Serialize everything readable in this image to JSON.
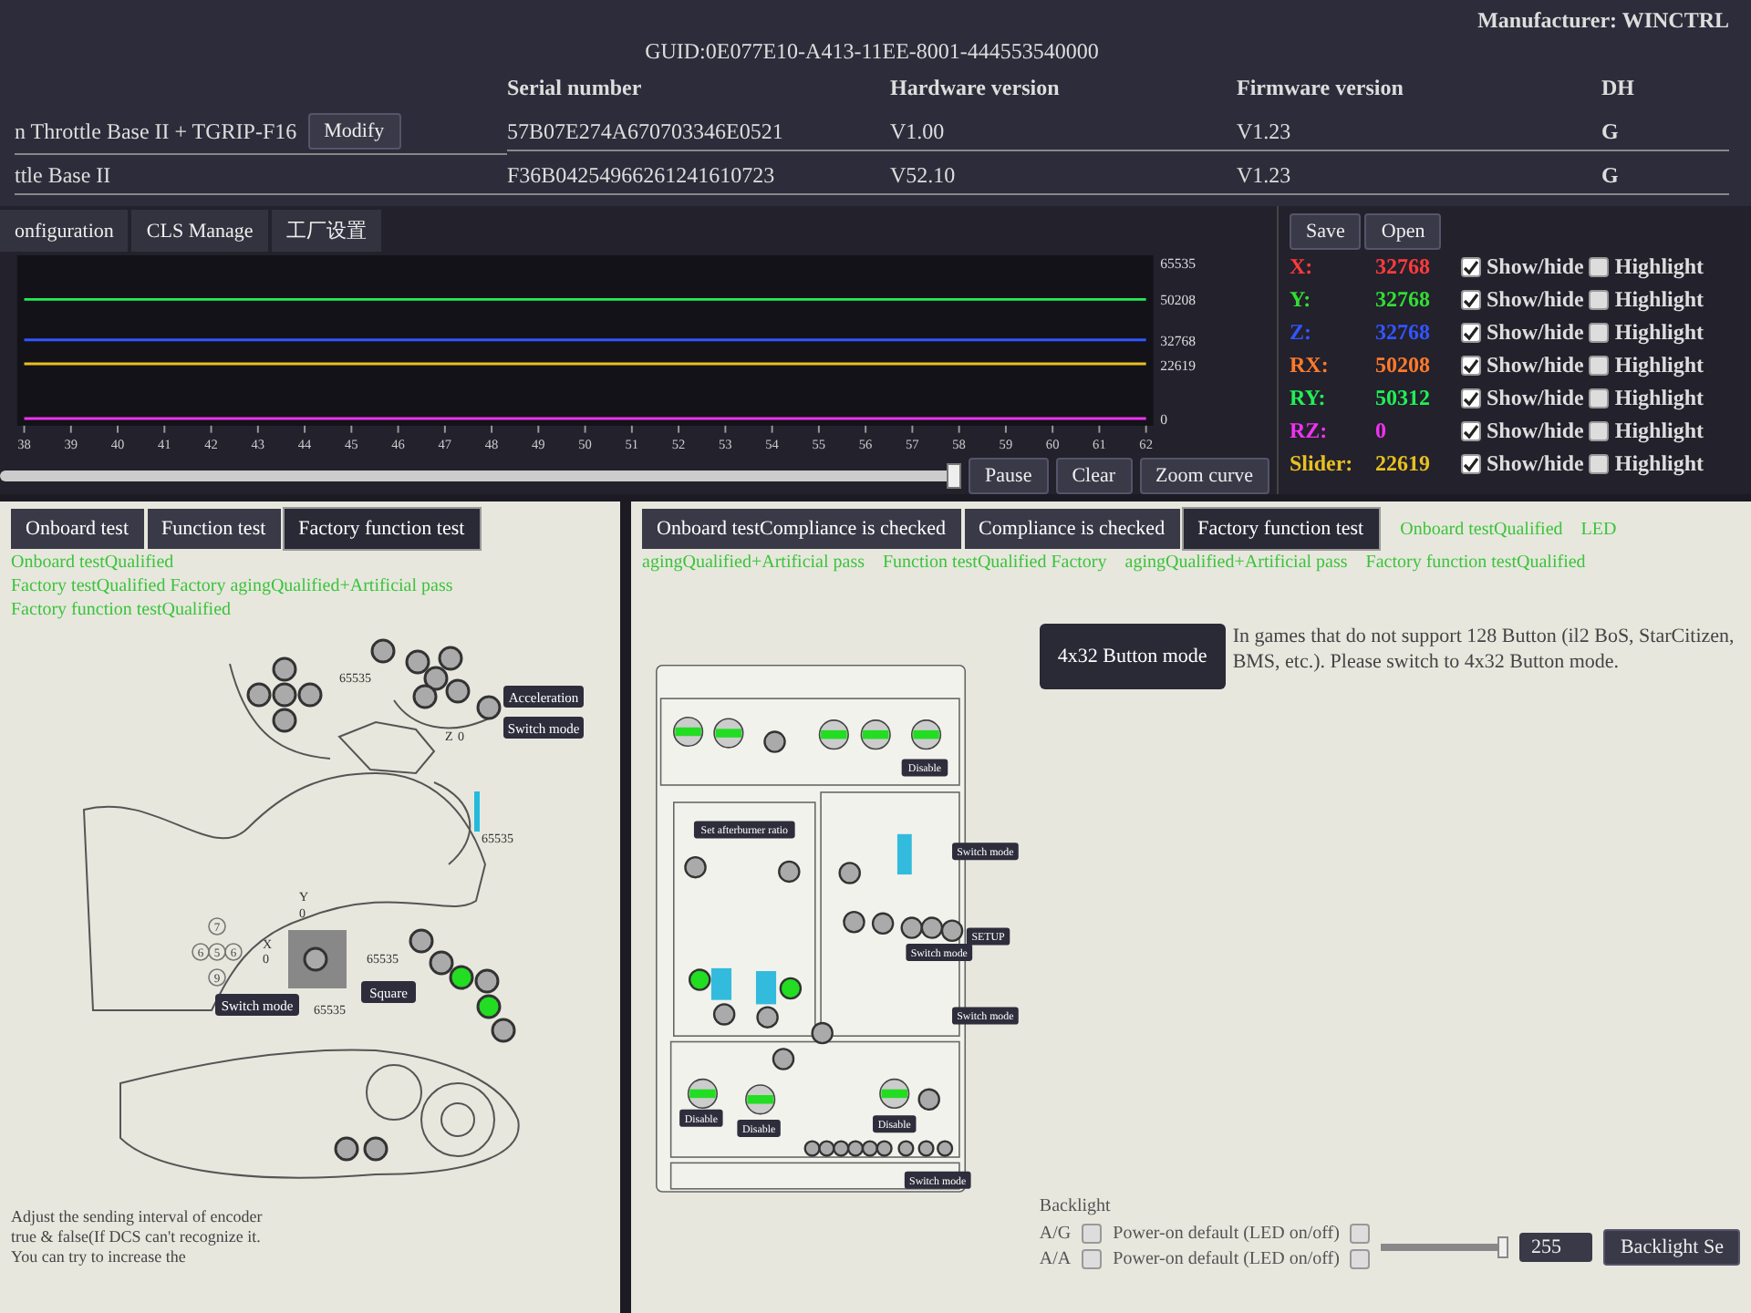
{
  "header": {
    "manufacturer": "Manufacturer: WINCTRL",
    "guid": "GUID:0E077E10-A413-11EE-8001-444553540000",
    "columns": [
      "Serial number",
      "Hardware version",
      "Firmware version",
      "DH"
    ],
    "rows": [
      {
        "name": "n Throttle Base II + TGRIP-F16",
        "action": "Modify",
        "serial": "57B07E274A670703346E0521",
        "hardware": "V1.00",
        "firmware": "V1.23",
        "dh": "G"
      },
      {
        "name": "ttle Base II",
        "serial": "F36B04254966261241610723",
        "hardware": "V52.10",
        "firmware": "V1.23",
        "dh": "G"
      }
    ]
  },
  "nav_tabs": [
    {
      "label": "onfiguration",
      "selected": false
    },
    {
      "label": "CLS Manage",
      "selected": false
    },
    {
      "label": "工厂设置",
      "selected": false
    }
  ],
  "chart": {
    "chart_data": {
      "type": "line",
      "categories": [
        "38",
        "39",
        "40",
        "41",
        "42",
        "43",
        "44",
        "45",
        "46",
        "47",
        "48",
        "49",
        "50",
        "51",
        "52",
        "53",
        "54",
        "55",
        "56",
        "57",
        "58",
        "59",
        "60",
        "61",
        "62"
      ],
      "yticks": [
        0,
        22619,
        32768,
        50208,
        65535
      ],
      "ylim": [
        0,
        65535
      ],
      "series": [
        {
          "color": "#3355ff",
          "values": [
            33000,
            33000,
            33000,
            33000,
            33000,
            33000,
            33000,
            33000,
            33000,
            33000,
            33000,
            33000,
            33000,
            33000,
            33000,
            33000,
            33000,
            33000,
            33000,
            33000,
            33000,
            33000,
            33000,
            33000,
            33000
          ]
        },
        {
          "color": "#22ee55",
          "values": [
            50000,
            50000,
            50000,
            50000,
            50000,
            50000,
            50000,
            50000,
            50000,
            50000,
            50000,
            50000,
            50000,
            50000,
            50000,
            50000,
            50000,
            50000,
            50000,
            50000,
            50000,
            50000,
            50000,
            50000,
            50000
          ]
        },
        {
          "color": "#ee33ee",
          "values": [
            0,
            0,
            0,
            0,
            0,
            0,
            0,
            0,
            0,
            0,
            0,
            0,
            0,
            0,
            0,
            0,
            0,
            0,
            0,
            0,
            0,
            0,
            0,
            0,
            0
          ]
        },
        {
          "color": "#e8c020",
          "values": [
            23000,
            23000,
            23000,
            23000,
            23000,
            23000,
            23000,
            23000,
            23000,
            23000,
            23000,
            23000,
            23000,
            23000,
            23000,
            23000,
            23000,
            23000,
            23000,
            23000,
            23000,
            23000,
            23000,
            23000,
            23000
          ]
        }
      ]
    },
    "controls": [
      "Pause",
      "Clear",
      "Zoom curve"
    ]
  },
  "legend": {
    "buttons": [
      "Save",
      "Open"
    ],
    "rows": [
      {
        "label": "X:",
        "value": "32768",
        "color": "#ff3b3b",
        "show": true,
        "show_label": "Show/hide",
        "highlight": false,
        "highlight_label": "Highlight"
      },
      {
        "label": "Y:",
        "value": "32768",
        "color": "#33dd33",
        "show": true,
        "show_label": "Show/hide",
        "highlight": false,
        "highlight_label": "Highlight"
      },
      {
        "label": "Z:",
        "value": "32768",
        "color": "#3355ff",
        "show": true,
        "show_label": "Show/hide",
        "highlight": false,
        "highlight_label": "Highlight"
      },
      {
        "label": "RX:",
        "value": "50208",
        "color": "#ff7a2a",
        "show": true,
        "show_label": "Show/hide",
        "highlight": false,
        "highlight_label": "Highlight"
      },
      {
        "label": "RY:",
        "value": "50312",
        "color": "#22ee55",
        "show": true,
        "show_label": "Show/hide",
        "highlight": false,
        "highlight_label": "Highlight"
      },
      {
        "label": "RZ:",
        "value": "0",
        "color": "#ee33ee",
        "show": true,
        "show_label": "Show/hide",
        "highlight": false,
        "highlight_label": "Highlight"
      },
      {
        "label": "Slider:",
        "value": "22619",
        "color": "#e8c020",
        "show": true,
        "show_label": "Show/hide",
        "highlight": false,
        "highlight_label": "Highlight"
      }
    ]
  },
  "left_panel": {
    "tabs": [
      {
        "label": "Onboard test",
        "selected": false
      },
      {
        "label": "Function test",
        "selected": false
      },
      {
        "label": "Factory function test",
        "selected": true
      }
    ],
    "status": [
      "Onboard testQualified",
      "Factory testQualified Factory agingQualified+Artificial pass",
      "Factory function testQualified"
    ],
    "indicators": [
      {
        "pressed": false
      },
      {
        "pressed": false
      },
      {
        "pressed": false
      },
      {
        "pressed": false
      },
      {
        "pressed": false
      },
      {
        "pressed": false
      },
      {
        "pressed": false
      },
      {
        "pressed": false
      },
      {
        "pressed": false
      },
      {
        "pressed": false
      },
      {
        "pressed": false
      },
      {
        "pressed": false
      },
      {
        "pressed": false
      },
      {
        "pressed": false
      },
      {
        "pressed": true
      },
      {
        "pressed": false
      },
      {
        "pressed": true
      },
      {
        "pressed": false
      },
      {
        "pressed": false
      },
      {
        "pressed": false
      },
      {
        "pressed": false
      }
    ],
    "buttons": [
      "Acceleration",
      "Switch mode",
      "Square",
      "Switch mode"
    ],
    "labels": [
      "65535",
      "Z",
      "0",
      "65535",
      "Y",
      "0",
      "X",
      "0",
      "65535",
      "65535"
    ],
    "hat_labels": [
      "7",
      "6",
      "5",
      "6",
      "9"
    ],
    "note": "Adjust the sending interval of encoder true & false(If DCS can't recognize it. You can try to increase the"
  },
  "right_panel": {
    "tabs": [
      {
        "label": "Onboard testCompliance is checked",
        "selected": false
      },
      {
        "label": "Compliance is checked",
        "selected": false
      },
      {
        "label": "Factory function test",
        "selected": true
      }
    ],
    "status": [
      "Onboard testQualified",
      "LED",
      "agingQualified+Artificial pass",
      "Function testQualified Factory",
      "agingQualified+Artificial pass",
      "Factory function testQualified"
    ],
    "knobs": [
      {
        "on": true
      },
      {
        "on": true
      },
      {
        "on": true
      },
      {
        "on": true
      },
      {
        "on": true
      },
      {
        "on": true
      },
      {
        "on": true
      },
      {
        "on": true
      }
    ],
    "indicators": [
      {
        "pressed": false
      },
      {
        "pressed": false
      },
      {
        "pressed": false
      },
      {
        "pressed": true
      },
      {
        "pressed": true
      },
      {
        "pressed": false
      },
      {
        "pressed": false
      },
      {
        "pressed": false
      },
      {
        "pressed": false
      },
      {
        "pressed": false
      },
      {
        "pressed": false
      },
      {
        "pressed": false
      },
      {
        "pressed": false
      },
      {
        "pressed": false
      },
      {
        "pressed": false
      },
      {
        "pressed": false
      },
      {
        "pressed": false
      },
      {
        "pressed": false
      },
      {
        "pressed": false
      },
      {
        "pressed": false
      },
      {
        "pressed": false
      },
      {
        "pressed": false
      },
      {
        "pressed": false
      },
      {
        "pressed": false
      },
      {
        "pressed": false
      }
    ],
    "buttons": [
      "Disable",
      "Set afterburner ratio",
      "Switch mode",
      "SETUP",
      "Switch mode",
      "Switch mode",
      "Disable",
      "Disable",
      "Disable",
      "Switch mode"
    ],
    "mode_button": "4x32 Button mode",
    "mode_note": "In games that do not support 128 Button (il2 BoS, StarCitizen, BMS, etc.). Please switch to 4x32 Button mode.",
    "backlight": {
      "title": "Backlight",
      "modes": [
        {
          "label": "A/G",
          "checked": false
        },
        {
          "label": "A/A",
          "checked": false
        }
      ],
      "level": 1,
      "value": "255",
      "options": [
        {
          "label": "Power-on default (LED on/off)",
          "checked": false
        },
        {
          "label": "Power-on default (LED on/off)",
          "checked": false
        }
      ],
      "button": "Backlight Se"
    }
  }
}
